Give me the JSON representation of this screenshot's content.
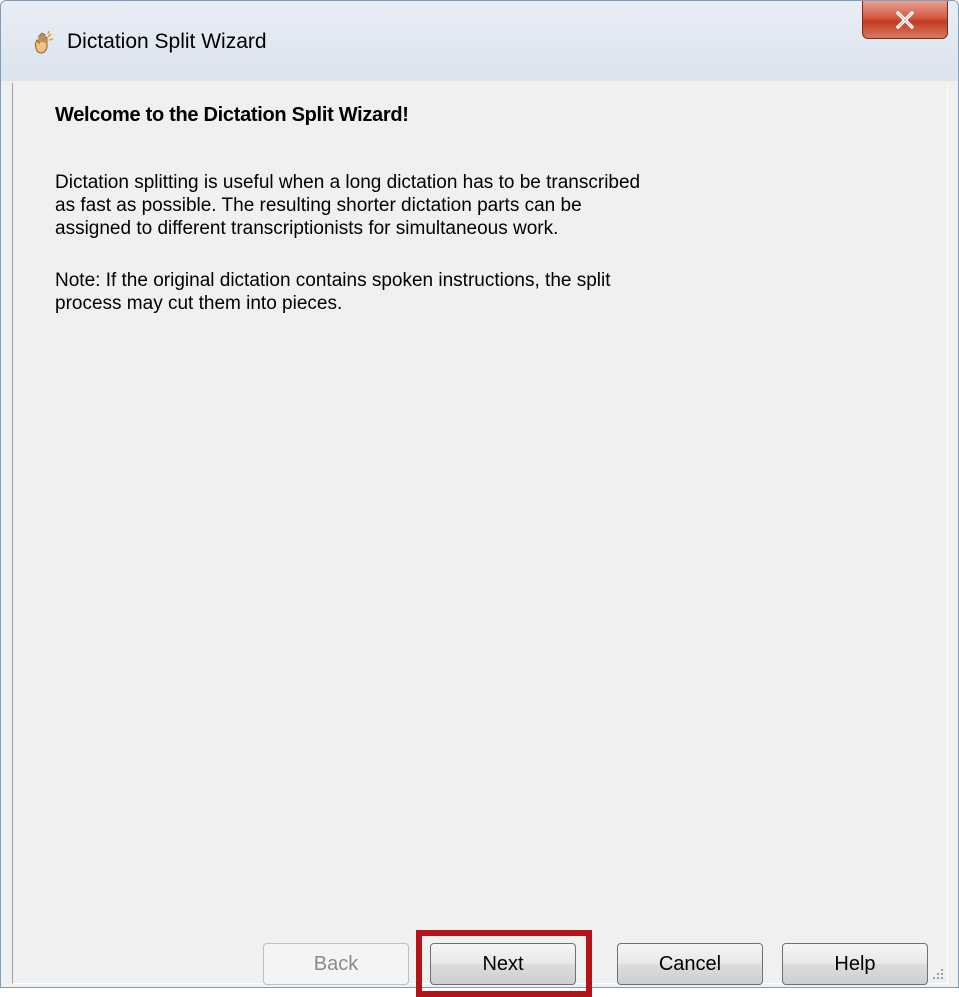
{
  "window": {
    "title": "Dictation Split Wizard",
    "title_icon": "dictation-hand-icon",
    "close_icon": "close-icon"
  },
  "content": {
    "heading": "Welcome to the Dictation Split Wizard!",
    "paragraph1": "Dictation splitting is useful when a long dictation has to be transcribed\nas fast as possible. The resulting shorter dictation parts can be\nassigned to different transcriptionists for simultaneous work.",
    "paragraph2": "Note: If the original dictation contains spoken instructions, the split\nprocess may cut them into pieces."
  },
  "buttons": {
    "back": "Back",
    "back_enabled": false,
    "next": "Next",
    "cancel": "Cancel",
    "help": "Help"
  },
  "colors": {
    "highlight": "#b5131a",
    "close_button": "#c23a22"
  }
}
